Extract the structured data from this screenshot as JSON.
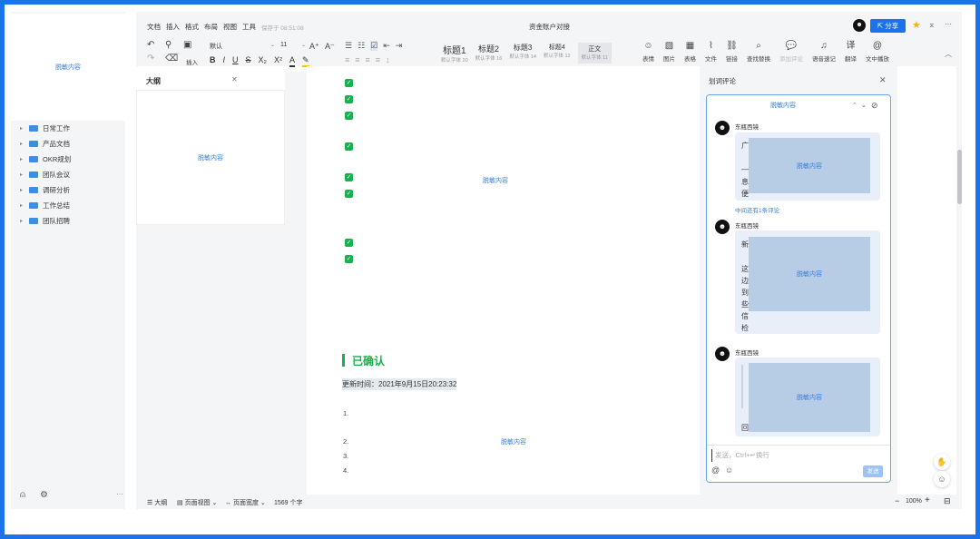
{
  "left_nav": {
    "masked_label": "脱敏内容",
    "folders": [
      "日常工作",
      "产品文档",
      "OKR规划",
      "团队会议",
      "调研分析",
      "工作总结",
      "团队招聘"
    ],
    "bottom_more": "···"
  },
  "outline": {
    "title": "大纲",
    "masked_label": "脱敏内容"
  },
  "menu": {
    "items": [
      "文档",
      "插入",
      "格式",
      "布局",
      "视图",
      "工具"
    ],
    "saved": "保存于 08:51:08"
  },
  "doc_title": "资金账户对接",
  "share_label": "分享",
  "more_label": "···",
  "toolbar": {
    "insert_label": "插入",
    "font_name": "默认",
    "font_size": "11",
    "headings": [
      {
        "name": "标题1",
        "sub": "默认字体 20"
      },
      {
        "name": "标题2",
        "sub": "默认字体 16"
      },
      {
        "name": "标题3",
        "sub": "默认字体 14"
      },
      {
        "name": "标题4",
        "sub": "默认字体 12"
      },
      {
        "name": "正文",
        "sub": "默认字体 11"
      }
    ],
    "right_tools": [
      "表情",
      "图片",
      "表格",
      "文件",
      "链接",
      "查找替换",
      "添加评论",
      "语音速记",
      "翻译",
      "文中播放"
    ]
  },
  "document": {
    "masked_label_1": "脱敏内容",
    "section_heading": "已确认",
    "update_time": "更新时间：2021年9月15日20:23:32",
    "list_numbers": [
      "1.",
      "2.",
      "3.",
      "4."
    ],
    "masked_label_2": "脱敏内容"
  },
  "comments": {
    "panel_title": "划词评论",
    "masked_quote": "脱敏内容",
    "author": "东瓶西镜",
    "more_replies": "中间还有1条评论",
    "masked_label": "脱敏内容",
    "fragments": {
      "c1": [
        "广",
        "—",
        "息",
        "便"
      ],
      "c2": [
        "新",
        "这",
        "边",
        "到",
        "些",
        "信",
        "检"
      ],
      "c3": [
        "回"
      ]
    },
    "input_placeholder": "发送，Ctrl+↵换行",
    "send_label": "发送"
  },
  "status_bar": {
    "outline": "大纲",
    "page_view": "页面视图",
    "page_width": "页面宽度",
    "word_count": "1569 个字",
    "zoom": "100%"
  }
}
